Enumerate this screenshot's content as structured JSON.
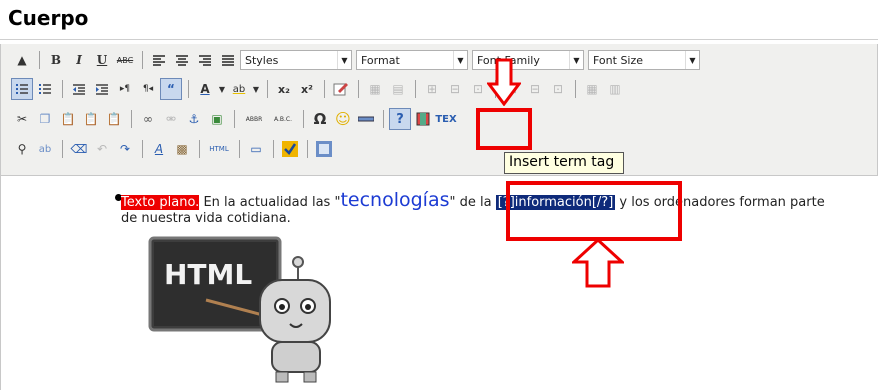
{
  "heading": {
    "title": "Cuerpo"
  },
  "toolbar": {
    "styles_select": "Styles",
    "format_select": "Format",
    "font_family_select": "Font Family",
    "font_size_select": "Font Size",
    "bold_label": "B",
    "italic_label": "I",
    "underline_label": "U",
    "strike_label": "ABC",
    "subscript_label": "x₂",
    "superscript_label": "x²",
    "omega_label": "Ω",
    "term_tag_label": "?",
    "tex_label": "TEX",
    "html_label": "HTML",
    "abbr_label": "ABBR",
    "acronym_label": "A.B.C."
  },
  "tooltip": {
    "text": "Insert term tag"
  },
  "content": {
    "highlighted_text": "Texto plano.",
    "text_before_keyword": " En la actualidad las \"",
    "keyword": "tecnologías",
    "text_after_keyword": "\" de la ",
    "term_tag": "[?]información[/?]",
    "text_after_tag": " y los ordenadores forman parte",
    "text_line2": "de nuestra vida cotidiana.",
    "image_text": "HTML"
  },
  "colors": {
    "annotation_red": "#e00000",
    "keyword_blue": "#1c3bd3",
    "tag_highlight": "#0e2a7a"
  }
}
